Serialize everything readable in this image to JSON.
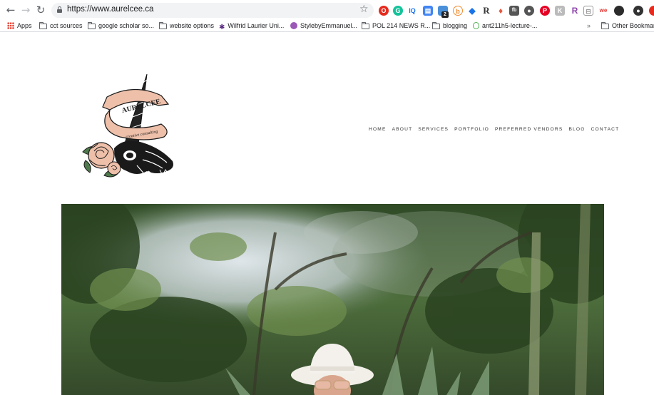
{
  "browser": {
    "url": "https://www.aurelcee.ca",
    "bookmarks": [
      {
        "label": "Apps",
        "icon": "apps-icon"
      },
      {
        "label": "cct sources",
        "icon": "folder-icon"
      },
      {
        "label": "google scholar so...",
        "icon": "folder-icon"
      },
      {
        "label": "website options",
        "icon": "folder-icon"
      },
      {
        "label": "Wilfrid Laurier Uni...",
        "icon": "maple-leaf-icon"
      },
      {
        "label": "StylebyEmmanuel...",
        "icon": "site-icon"
      },
      {
        "label": "POL 214 NEWS R...",
        "icon": "folder-icon"
      },
      {
        "label": "blogging",
        "icon": "folder-icon"
      },
      {
        "label": "ant211h5-lecture-...",
        "icon": "apple-icon"
      }
    ],
    "overflow_label": "»",
    "other_bookmarks": "Other Bookmarks",
    "ext_badge": "2"
  },
  "site": {
    "logo": {
      "banner_text": "AURELCEE",
      "tagline": "creative consulting"
    },
    "nav": [
      "HOME",
      "ABOUT",
      "SERVICES",
      "PORTFOLIO",
      "PREFERRED VENDORS",
      "BLOG",
      "CONTACT"
    ]
  },
  "colors": {
    "accent_pink": "#eec0aa",
    "ink": "#1a1a1a",
    "leaf": "#4f7a4c"
  }
}
